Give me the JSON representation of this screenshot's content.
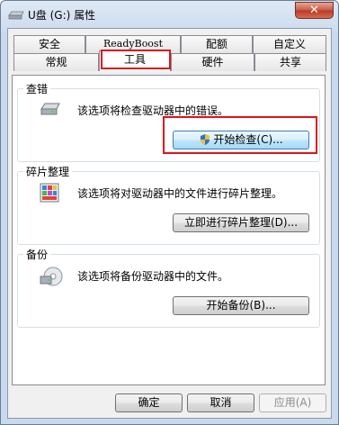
{
  "window": {
    "title": "U盘 (G:) 属性",
    "close_label": "✕"
  },
  "tabs_row1": [
    "安全",
    "ReadyBoost",
    "配额",
    "自定义"
  ],
  "tabs_row2": [
    "常规",
    "工具",
    "硬件",
    "共享"
  ],
  "active_tab": "工具",
  "groups": {
    "check": {
      "title": "查错",
      "desc": "该选项将检查驱动器中的错误。",
      "button": "开始检查(C)..."
    },
    "defrag": {
      "title": "碎片整理",
      "desc": "该选项将对驱动器中的文件进行碎片整理。",
      "button": "立即进行碎片整理(D)..."
    },
    "backup": {
      "title": "备份",
      "desc": "该选项将备份驱动器中的文件。",
      "button": "开始备份(B)..."
    }
  },
  "footer": {
    "ok": "确定",
    "cancel": "取消",
    "apply": "应用(A)"
  }
}
